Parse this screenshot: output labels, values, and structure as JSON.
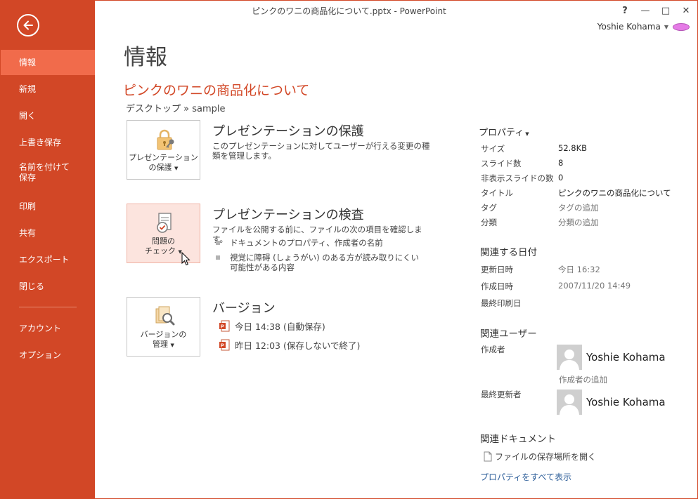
{
  "window": {
    "title": "ピンクのワニの商品化について.pptx - PowerPoint",
    "help_label": "?",
    "minimize_label": "—",
    "maximize_label": "□",
    "close_label": "✕",
    "user_name": "Yoshie Kohama"
  },
  "sidebar": {
    "accent": "#d24726",
    "items": [
      {
        "label": "情報"
      },
      {
        "label": "新規"
      },
      {
        "label": "開く"
      },
      {
        "label": "上書き保存"
      },
      {
        "label": "名前を付けて保存"
      },
      {
        "label": "印刷"
      },
      {
        "label": "共有"
      },
      {
        "label": "エクスポート"
      },
      {
        "label": "閉じる"
      },
      {
        "label": "アカウント"
      },
      {
        "label": "オプション"
      }
    ]
  },
  "main": {
    "heading": "情報",
    "doc_name": "ピンクのワニの商品化について",
    "breadcrumb": "デスクトップ » sample",
    "protect": {
      "button_line1": "プレゼンテーション",
      "button_line2": "の保護",
      "title": "プレゼンテーションの保護",
      "description": "このプレゼンテーションに対してユーザーが行える変更の種類を管理します。"
    },
    "inspect": {
      "button_line1": "問題の",
      "button_line2": "チェック",
      "title": "プレゼンテーションの検査",
      "description": "ファイルを公開する前に、ファイルの次の項目を確認します。",
      "bullets": [
        "ドキュメントのプロパティ、作成者の名前",
        "視覚に障碍 (しょうがい) のある方が読み取りにくい可能性がある内容"
      ]
    },
    "versions": {
      "button_line1": "バージョンの",
      "button_line2": "管理",
      "title": "バージョン",
      "items": [
        "今日 14:38 (自動保存)",
        "昨日 12:03 (保存しないで終了)"
      ]
    }
  },
  "properties": {
    "header": "プロパティ",
    "rows": [
      {
        "label": "サイズ",
        "value": "52.8KB"
      },
      {
        "label": "スライド数",
        "value": "8"
      },
      {
        "label": "非表示スライドの数",
        "value": "0"
      },
      {
        "label": "タイトル",
        "value": "ピンクのワニの商品化について"
      },
      {
        "label": "タグ",
        "value": "タグの追加"
      },
      {
        "label": "分類",
        "value": "分類の追加"
      }
    ],
    "dates_title": "関連する日付",
    "dates": [
      {
        "label": "更新日時",
        "value": "今日 16:32"
      },
      {
        "label": "作成日時",
        "value": "2007/11/20 14:49"
      },
      {
        "label": "最終印刷日",
        "value": ""
      }
    ],
    "people_title": "関連ユーザー",
    "author_label": "作成者",
    "author_name": "Yoshie Kohama",
    "add_author": "作成者の追加",
    "last_modified_label": "最終更新者",
    "last_modified_name": "Yoshie Kohama",
    "docs_title": "関連ドキュメント",
    "open_location": "ファイルの保存場所を開く",
    "show_all": "プロパティをすべて表示"
  }
}
